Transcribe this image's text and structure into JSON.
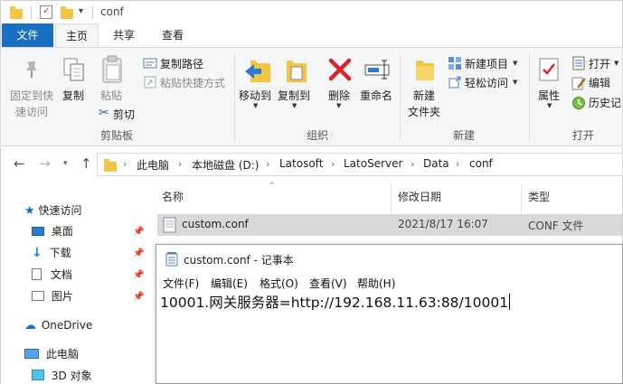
{
  "window": {
    "title": "conf"
  },
  "ribbon_tabs": [
    "文件",
    "主页",
    "共享",
    "查看"
  ],
  "ribbon": {
    "clipboard": {
      "pin_quick_access": "固定到快速访问",
      "copy": "复制",
      "paste": "粘贴",
      "copy_path": "复制路径",
      "paste_shortcut": "粘贴快捷方式",
      "cut": "剪切",
      "group_label": "剪贴板"
    },
    "organize": {
      "move_to": "移动到",
      "copy_to": "复制到",
      "delete": "删除",
      "rename": "重命名",
      "group_label": "组织"
    },
    "new": {
      "new_folder": "新建文件夹",
      "new_item": "新建项目",
      "easy_access": "轻松访问",
      "group_label": "新建"
    },
    "open": {
      "properties": "属性",
      "open": "打开",
      "edit": "编辑",
      "history": "历史记",
      "group_label": "打开"
    }
  },
  "breadcrumb": [
    "此电脑",
    "本地磁盘 (D:)",
    "Latosoft",
    "LatoServer",
    "Data",
    "conf"
  ],
  "nav_pane": {
    "quick_access": "快速访问",
    "items": [
      "桌面",
      "下载",
      "文档",
      "图片"
    ],
    "onedrive": "OneDrive",
    "this_pc": "此电脑",
    "objects_3d": "3D 对象"
  },
  "file_list": {
    "columns": [
      "名称",
      "修改日期",
      "类型"
    ],
    "rows": [
      {
        "name": "custom.conf",
        "modified": "2021/8/17 16:07",
        "type": "CONF 文件"
      }
    ]
  },
  "notepad": {
    "title": "custom.conf - 记事本",
    "menu": [
      "文件(F)",
      "编辑(E)",
      "格式(O)",
      "查看(V)",
      "帮助(H)"
    ],
    "content": "10001.网关服务器=http://192.168.11.63:88/10001"
  },
  "colors": {
    "file_tab": "#1a6fc2",
    "folder": "#f4c542",
    "delete_x": "#d7262b",
    "selection": "#d9d9d9"
  }
}
